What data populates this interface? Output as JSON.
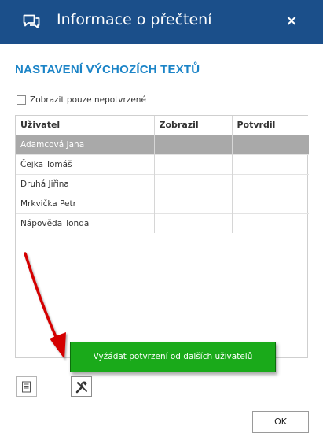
{
  "dialog": {
    "title": "Informace o přečtení",
    "close_label": "×"
  },
  "section": {
    "heading": "NASTAVENÍ VÝCHOZÍCH TEXTŮ"
  },
  "filter": {
    "checkbox_label": "Zobrazit pouze nepotvrzené",
    "checked": false
  },
  "table": {
    "columns": [
      "Uživatel",
      "Zobrazil",
      "Potvrdil"
    ],
    "rows": [
      {
        "user": "Adamcová Jana",
        "shown": "",
        "confirmed": "",
        "selected": true
      },
      {
        "user": "Čejka Tomáš",
        "shown": "",
        "confirmed": ""
      },
      {
        "user": "Druhá Jiřina",
        "shown": "",
        "confirmed": ""
      },
      {
        "user": "Mrkvička Petr",
        "shown": "",
        "confirmed": ""
      },
      {
        "user": "Nápověda Tonda",
        "shown": "",
        "confirmed": ""
      }
    ]
  },
  "toolbar": {
    "document_icon": "document-icon",
    "tools_icon": "tools-icon",
    "tooltip": "Vyžádat potvrzení od dalších uživatelů"
  },
  "footer": {
    "ok_label": "OK"
  },
  "colors": {
    "titlebar": "#1b4f8a",
    "heading": "#1b84c7",
    "selected_row": "#a9a9a9",
    "tooltip": "#1aaa1a",
    "arrow": "#d40000"
  }
}
